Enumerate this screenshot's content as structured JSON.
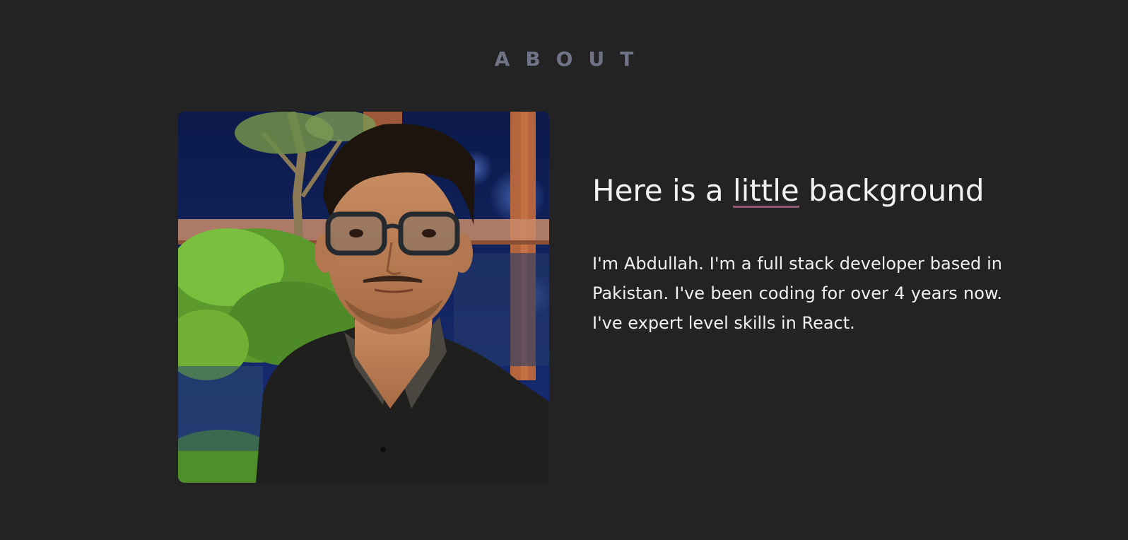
{
  "about": {
    "title": "ABOUT",
    "heading_before": "Here is a ",
    "heading_highlight": "little",
    "heading_after": " background",
    "bio": "I'm Abdullah. I'm a full stack developer based in Pakistan. I've been coding for over 4 years now. I've expert level skills in React."
  },
  "colors": {
    "background": "#232323",
    "title": "#6f7385",
    "text": "#f2f2f2",
    "highlight_underline": "#8e5a73"
  }
}
